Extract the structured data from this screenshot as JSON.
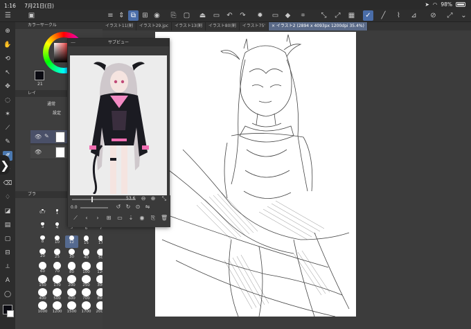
{
  "statusbar": {
    "time": "1:16",
    "date": "7月21日(日)",
    "battery": "98%"
  },
  "tabs": [
    {
      "label": "イラスト11(割",
      "active": false
    },
    {
      "label": "イラスト29.jpc",
      "active": false
    },
    {
      "label": "イラスト13(割",
      "active": false
    },
    {
      "label": "イラスト80(割",
      "active": false
    },
    {
      "label": "イラスト75'",
      "active": false
    },
    {
      "label": "× イラスト2 (2894 x 4093px 1200dpi 35.4%)",
      "active": true
    }
  ],
  "panels": {
    "color_circle_title": "カラーサークル",
    "layer_title": "レイ",
    "brush_title": "ブラ",
    "layer_opacity": "21",
    "layer_blend": "通常",
    "layer_mode": "設定"
  },
  "brush_sizes": [
    "0.7",
    "1",
    "1.5",
    "2",
    "2.5",
    "3",
    "4",
    "5",
    "6",
    "7",
    "8",
    "10",
    "12",
    "15",
    "17",
    "20",
    "25",
    "30",
    "40",
    "50",
    "60",
    "70",
    "80",
    "100",
    "120",
    "150",
    "170",
    "200",
    "250",
    "300",
    "400",
    "500",
    "600",
    "700",
    "800",
    "1000",
    "1200",
    "1500",
    "1700",
    "2000"
  ],
  "brush_selected": "12",
  "brush_header_value": "0.7",
  "subview": {
    "title": "サブビュー",
    "zoom": "53.6",
    "rotation": "0.0"
  },
  "colors": {
    "accent": "#4a6da8",
    "main_color": "#0b0b12",
    "sub_color": "#ffffff"
  }
}
